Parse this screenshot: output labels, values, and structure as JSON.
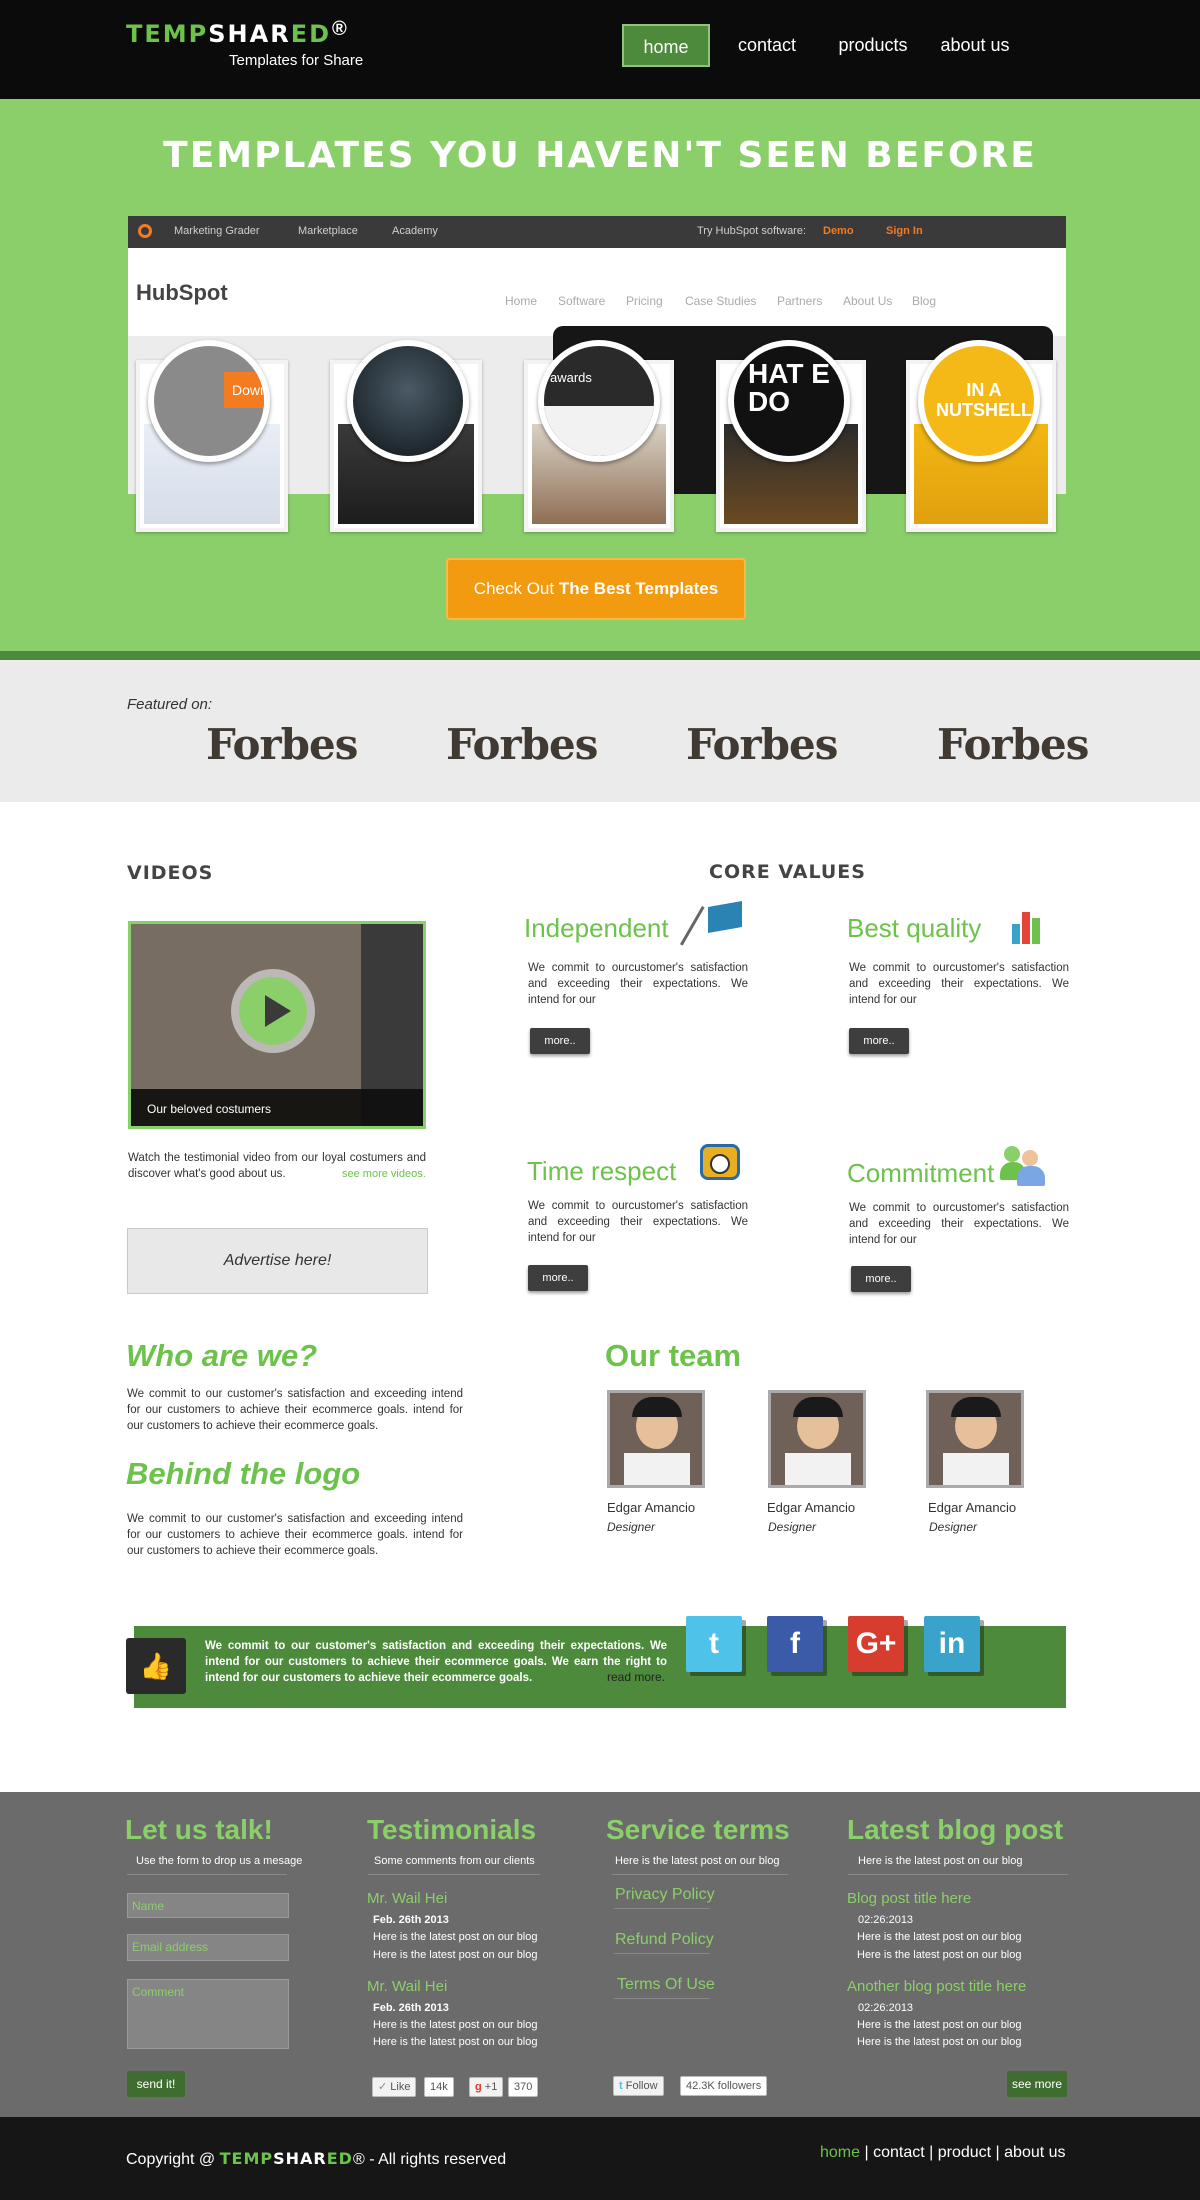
{
  "header": {
    "logo_part1": "TEMP",
    "logo_part2": "SHAR",
    "logo_part3": "ED",
    "logo_reg": "®",
    "tagline": "Templates for Share",
    "nav": [
      {
        "label": "home"
      },
      {
        "label": "contact"
      },
      {
        "label": "products"
      },
      {
        "label": "about us"
      }
    ]
  },
  "hero": {
    "title": "TEMPLATES YOU HAVEN'T SEEN BEFORE",
    "mock": {
      "topbar": [
        "Marketing Grader",
        "Marketplace",
        "Academy"
      ],
      "try_text": "Try HubSpot software:",
      "demo": "Demo",
      "signin": "Sign In",
      "logo": "HubSpot",
      "nav": [
        "Home",
        "Software",
        "Pricing",
        "Case Studies",
        "Partners",
        "About Us",
        "Blog"
      ]
    },
    "circle_texts": [
      "Down",
      "",
      "awards",
      "HAT E DO",
      "IN A NUTSHELL"
    ],
    "cta_normal": "Check Out ",
    "cta_bold": "The Best Templates"
  },
  "featured": {
    "label": "Featured on:",
    "logos": [
      "Forbes",
      "Forbes",
      "Forbes",
      "Forbes"
    ]
  },
  "videos": {
    "heading": "VIDEOS",
    "caption": "Our beloved costumers",
    "description": "Watch the testimonial video from our loyal costumers and discover what's good about us.",
    "link": "see more videos.",
    "advert": "Advertise here!"
  },
  "core_values": {
    "heading": "CORE VALUES",
    "items": [
      {
        "title": "Independent",
        "text": "We commit to ourcustomer's satisfaction and exceeding their expectations. We intend for our",
        "button": "more.."
      },
      {
        "title": "Best quality",
        "text": "We commit to ourcustomer's satisfaction and exceeding their expectations. We intend for our",
        "button": "more.."
      },
      {
        "title": "Time respect",
        "text": "We commit to ourcustomer's satisfaction and exceeding their expectations. We intend for our",
        "button": "more.."
      },
      {
        "title": "Commitment",
        "text": "We commit to ourcustomer's satisfaction and exceeding their expectations. We intend for our",
        "button": "more.."
      }
    ]
  },
  "about": {
    "who_heading": "Who are we?",
    "who_text": "We commit to our customer's satisfaction and exceeding intend for our customers to achieve their ecommerce goals. intend for our customers to achieve their ecommerce goals.",
    "logo_heading": "Behind the logo",
    "logo_text": "We commit to our customer's satisfaction and exceeding intend for our customers to achieve their ecommerce goals. intend for our customers to achieve their ecommerce goals."
  },
  "team": {
    "heading": "Our team",
    "members": [
      {
        "name": "Edgar Amancio",
        "role": "Designer"
      },
      {
        "name": "Edgar Amancio",
        "role": "Designer"
      },
      {
        "name": "Edgar Amancio",
        "role": "Designer"
      }
    ]
  },
  "banner": {
    "text": "We commit to our customer's satisfaction and exceeding their expectations. We intend for our customers to achieve their ecommerce goals. We earn the right to intend for our customers to achieve their ecommerce goals.",
    "read_more": "read more.",
    "social": [
      "t",
      "f",
      "G+",
      "in"
    ],
    "social_colors": [
      "#4ec2e8",
      "#3b5ba8",
      "#d63d2f",
      "#3aa3cc"
    ]
  },
  "footer": {
    "talk": {
      "heading": "Let us talk!",
      "sub": "Use the form to drop us a mesage",
      "name_placeholder": "Name",
      "email_placeholder": "Email address",
      "comment_placeholder": "Comment",
      "send": "send it!"
    },
    "testimonials": {
      "heading": "Testimonials",
      "sub": "Some comments from our clients",
      "items": [
        {
          "name": "Mr. Wail Hei",
          "date": "Feb. 26th 2013",
          "line1": "Here is the latest post on our blog",
          "line2": "Here is the latest post on our blog"
        },
        {
          "name": "Mr. Wail Hei",
          "date": "Feb. 26th 2013",
          "line1": "Here is the latest post on our blog",
          "line2": "Here is the latest post on our blog"
        }
      ],
      "like_label": "Like",
      "like_count": "14k",
      "plus_label": "+1",
      "plus_count": "370"
    },
    "service": {
      "heading": "Service terms",
      "sub": "Here is the latest post on our blog",
      "links": [
        "Privacy Policy",
        "Refund Policy",
        "Terms Of Use"
      ],
      "follow_label": "Follow",
      "followers": "42.3K followers"
    },
    "blog": {
      "heading": "Latest  blog post",
      "sub": "Here is the latest post on our blog",
      "posts": [
        {
          "title": "Blog post title here",
          "date": "02:26:2013",
          "line1": "Here is the latest post on our blog",
          "line2": "Here is the latest post on our blog"
        },
        {
          "title": "Another blog post title here",
          "date": "02:26:2013",
          "line1": "Here is the latest post on our blog",
          "line2": "Here is the latest post on our blog"
        }
      ],
      "see_more": "see more"
    }
  },
  "bottom": {
    "copyright_prefix": "Copyright @ ",
    "brand_part1": "TEMP",
    "brand_part2": "SHAR",
    "brand_part3": "ED",
    "brand_reg": "®",
    "copyright_suffix": " - All rights reserved",
    "nav": [
      "home",
      "contact",
      "product",
      "about us"
    ]
  }
}
